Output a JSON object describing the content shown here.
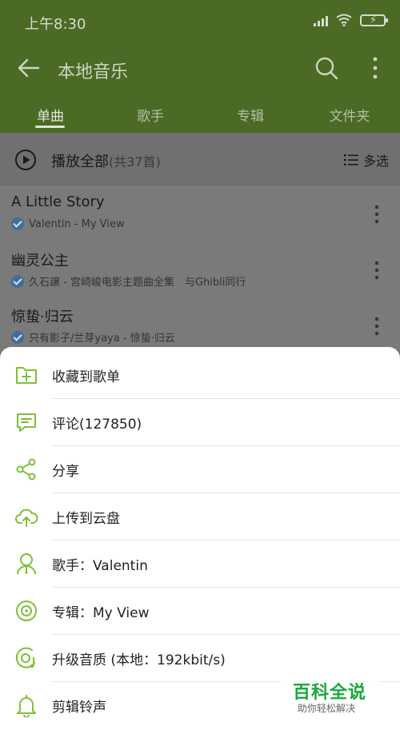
{
  "status_bar": {
    "time": "上午8:30"
  },
  "header": {
    "title": "本地音乐",
    "tabs": [
      {
        "label": "单曲",
        "active": true
      },
      {
        "label": "歌手",
        "active": false
      },
      {
        "label": "专辑",
        "active": false
      },
      {
        "label": "文件夹",
        "active": false
      }
    ]
  },
  "play_all": {
    "label": "播放全部",
    "count": "(共37首)",
    "multi_select": "多选"
  },
  "songs": [
    {
      "title": "A Little Story",
      "subtitle": "Valentin - My View"
    },
    {
      "title": "幽灵公主",
      "subtitle": "久石譲 - 宫崎峻电影主题曲全集　与Ghibli同行"
    },
    {
      "title": "惊蛰·归云",
      "subtitle": "只有影子/兰芽yaya - 惊蛰·归云"
    }
  ],
  "sheet": {
    "items": [
      {
        "label": "收藏到歌单",
        "icon": "folder-add-icon"
      },
      {
        "label": "评论(127850)",
        "icon": "comment-icon"
      },
      {
        "label": "分享",
        "icon": "share-icon"
      },
      {
        "label": "上传到云盘",
        "icon": "cloud-upload-icon"
      },
      {
        "label": "歌手：Valentin",
        "icon": "singer-icon"
      },
      {
        "label": "专辑：My View",
        "icon": "album-icon"
      },
      {
        "label": "升级音质 (本地：192kbit/s)",
        "icon": "quality-icon"
      },
      {
        "label": "剪辑铃声",
        "icon": "bell-icon"
      }
    ]
  },
  "watermark": {
    "title": "百科全说",
    "subtitle": "助你轻松解决"
  },
  "colors": {
    "accent": "#7fbf3a",
    "header": "#4a6a25",
    "overlay": "#7a7a7a"
  }
}
